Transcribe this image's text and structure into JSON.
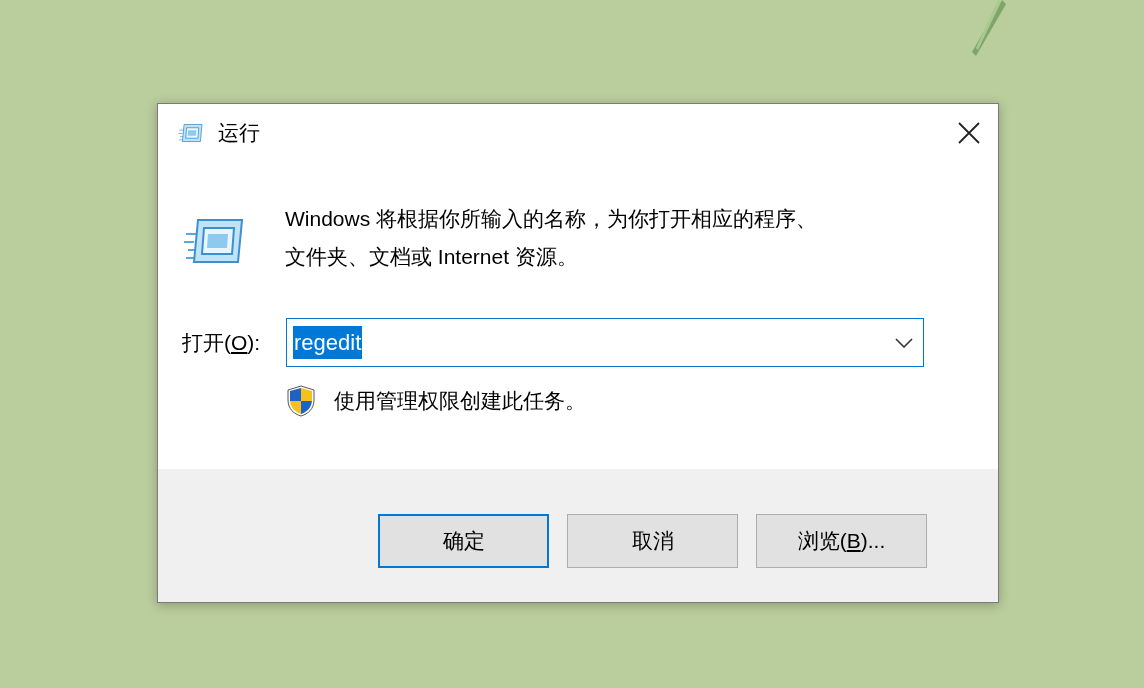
{
  "window": {
    "title": "运行"
  },
  "description_lines": [
    "Windows 将根据你所输入的名称，为你打开相应的程序、",
    "文件夹、文档或 Internet 资源。"
  ],
  "open_field": {
    "label_parts": [
      {
        "text": "打开(",
        "underline": false
      },
      {
        "text": "O",
        "underline": true
      },
      {
        "text": "):",
        "underline": false
      }
    ],
    "value": "regedit",
    "value_selected": true
  },
  "admin_note": "使用管理权限创建此任务。",
  "buttons": [
    {
      "label_parts": [
        {
          "text": "确定",
          "underline": false
        }
      ],
      "default": true
    },
    {
      "label_parts": [
        {
          "text": "取消",
          "underline": false
        }
      ],
      "default": false
    },
    {
      "label_parts": [
        {
          "text": "浏览(",
          "underline": false
        },
        {
          "text": "B",
          "underline": true
        },
        {
          "text": ")...",
          "underline": false
        }
      ],
      "default": false
    }
  ]
}
